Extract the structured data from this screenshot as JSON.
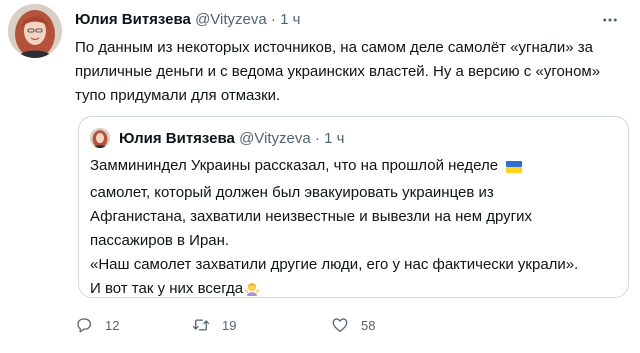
{
  "author": {
    "name": "Юлия Витязева",
    "handle": "@Vityzeva",
    "separator": "·",
    "time": "1 ч"
  },
  "tweet_text": "По данным из некоторых источников, на самом деле самолёт «угнали» за приличные деньги и с ведома украинских властей. Ну а версию с «угоном» тупо придумали для отмазки.",
  "quoted": {
    "name": "Юлия Витязева",
    "handle": "@Vityzeva",
    "separator": "·",
    "time": "1 ч",
    "lines": [
      "Заммининдел Украины рассказал, что на прошлой неделе",
      "самолет, который должен был эвакуировать украинцев из",
      "Афганистана, захватили неизвестные и вывезли на нем других",
      "пассажиров в Иран.",
      "«Наш самолет захватили другие люди, его у нас фактически украли».",
      "И вот так у них всегда"
    ],
    "emojis": [
      "ukraine-flag-icon",
      "woman-shrugging-icon"
    ]
  },
  "actions": {
    "reply_count": "12",
    "retweet_count": "19",
    "like_count": "58"
  },
  "colors": {
    "text": "#0f1419",
    "secondary": "#536471",
    "border": "#cfd9de",
    "background": "#ffffff"
  }
}
